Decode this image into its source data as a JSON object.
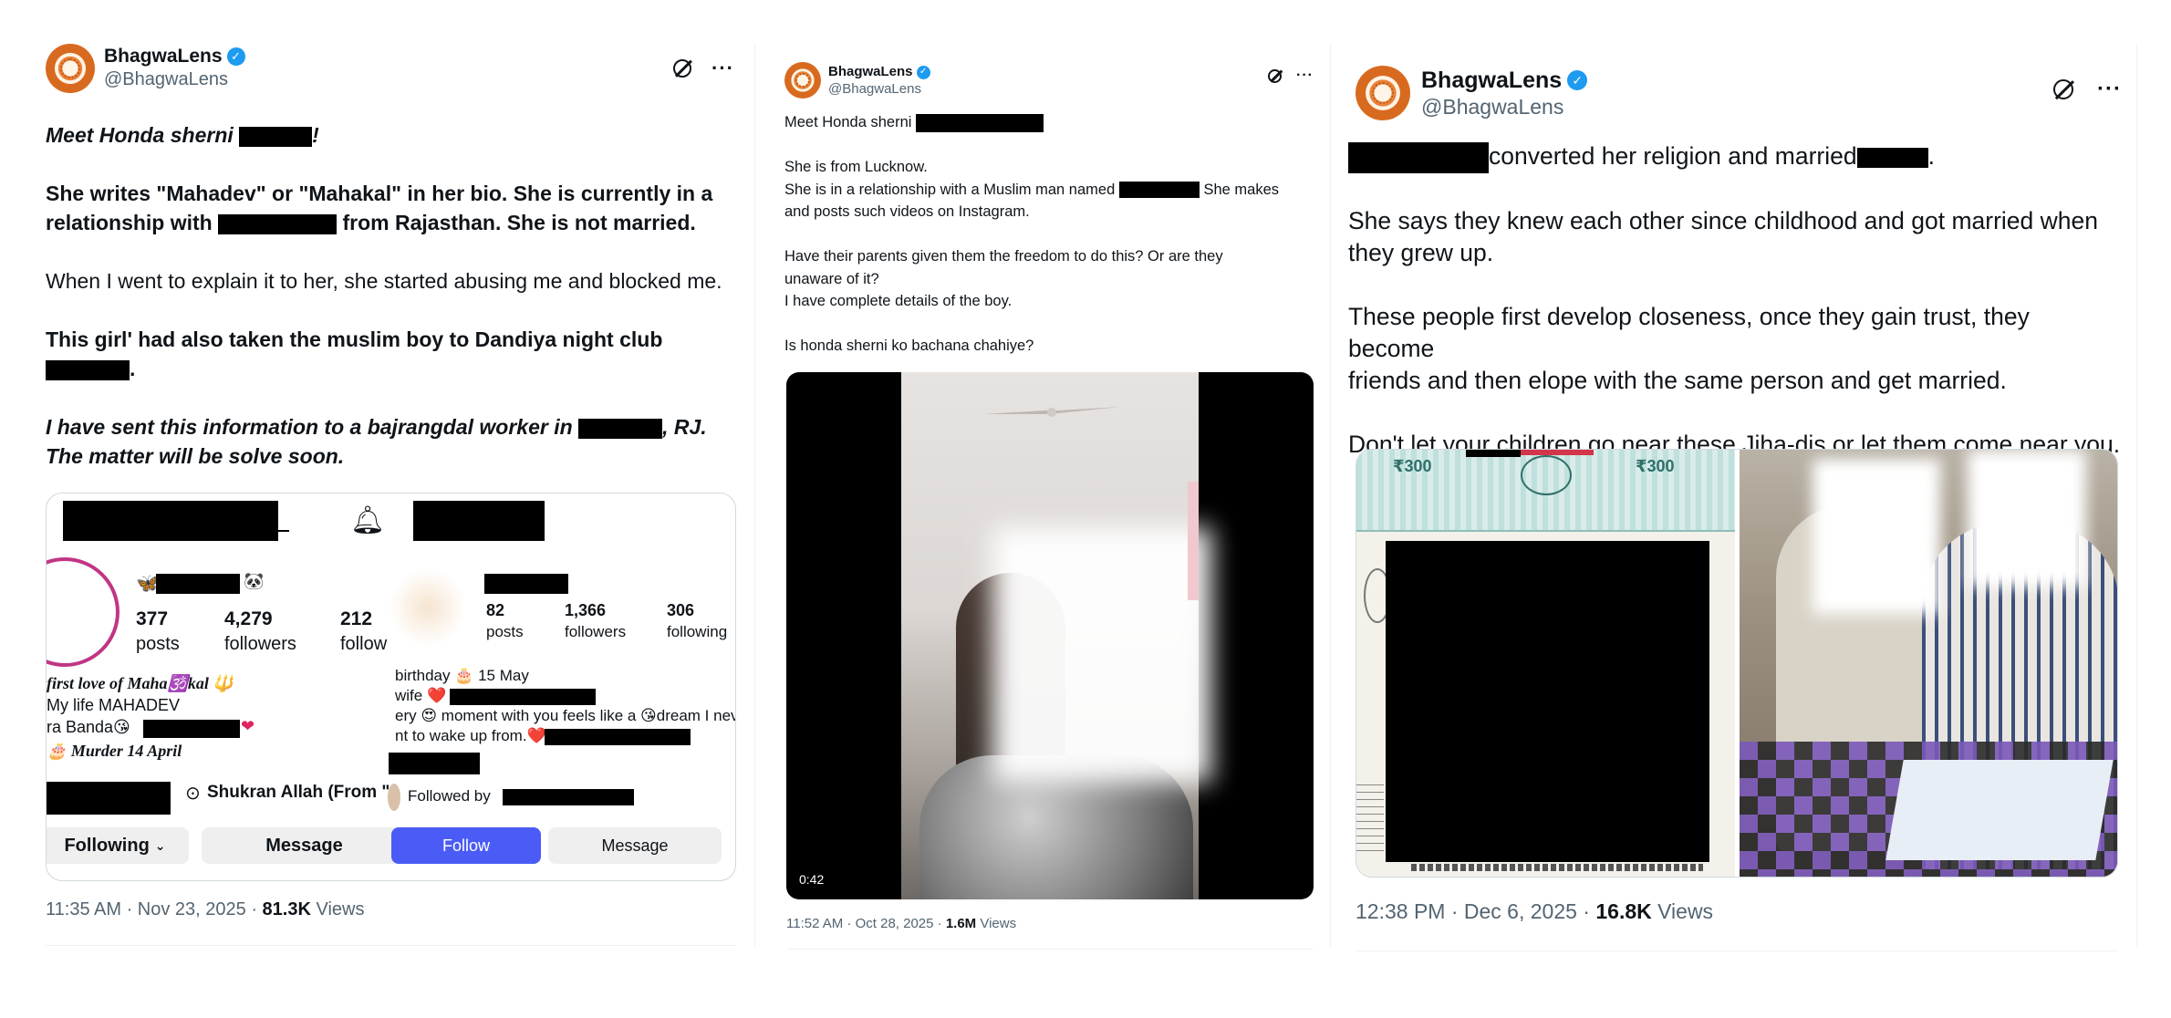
{
  "panel1": {
    "name": "BhagwaLens",
    "handle": "@BhagwaLens",
    "l1_pre": "Meet Honda sherni",
    "l1_post": "!",
    "l2a": "She writes \"Mahadev\" or \"Mahakal\" in her bio. She is currently in a",
    "l2b_pre": "relationship with",
    "l2b_post": "from Rajasthan. She is not married.",
    "l3": "When I went to explain it to her, she started abusing me and blocked me.",
    "l4a": "This girl' had also taken the muslim boy to Dandiya night club",
    "l4b_post": ".",
    "l5a_pre": "I have sent this information to a bajrangdal worker in",
    "l5a_post": ", RJ.",
    "l5b": "The matter will be solve soon.",
    "timestamp": "11:35 AM · Nov 23, 2025 ·",
    "views_count": "81.3K",
    "views_label": "Views",
    "ig": {
      "left": {
        "posts_num": "377",
        "posts_lbl": "posts",
        "followers_num": "4,279",
        "followers_lbl": "followers",
        "following_num": "212",
        "following_lbl": "follow",
        "bio1": "first love of Maha🕉️kal 🔱",
        "bio2": "My life MAHADEV",
        "bio3_pre": "ra Banda😘",
        "bio4": "🎂 Murder 14 April",
        "story": "Shukran Allah (From \"",
        "following_btn": "Following",
        "message_btn": "Message"
      },
      "right": {
        "posts_num": "82",
        "posts_lbl": "posts",
        "followers_num": "1,366",
        "followers_lbl": "followers",
        "following_num": "306",
        "following_lbl": "following",
        "bio1": "birthday 🎂 15 May",
        "bio2": "wife ❤️",
        "bio3": "ery 😍 moment with you feels like a 😘dream I nev",
        "bio4": "nt to wake up from.❤️",
        "followed_by": "Followed by",
        "follow_btn": "Follow",
        "message_btn": "Message"
      }
    }
  },
  "panel2": {
    "name": "BhagwaLens",
    "handle": "@BhagwaLens",
    "l1_pre": "Meet Honda sherni",
    "l2": "She is from Lucknow.",
    "l3_pre": "She is in a relationship with a Muslim man named",
    "l3_post": "She makes",
    "l4": "and posts such videos on Instagram.",
    "l5": "Have their parents given them the freedom to do this? Or are they",
    "l6": "unaware of it?",
    "l7": "I have complete details of the boy.",
    "l8": "Is honda sherni ko bachana chahiye?",
    "video_time": "0:42",
    "timestamp": "11:52 AM · Oct 28, 2025 ·",
    "views_count": "1.6M",
    "views_label": "Views"
  },
  "panel3": {
    "name": "BhagwaLens",
    "handle": "@BhagwaLens",
    "l1_mid": "converted her religion and married",
    "l1_end": ".",
    "l2a": "She says they knew each other since childhood and got married when",
    "l2b": "they grew up.",
    "l3a": "These people first develop closeness, once they gain trust, they become",
    "l3b": "friends and then elope with the same person and get married.",
    "l4": "Don't let your children go near these Jiha-dis or let them come near you.",
    "stamp_left": "₹300",
    "stamp_right": "₹300",
    "timestamp": "12:38 PM · Dec 6, 2025 ·",
    "views_count": "16.8K",
    "views_label": "Views"
  },
  "colors": {
    "verified": "#1d9bf0",
    "secondary_text": "#536471",
    "follow_button": "#4a5cf5"
  }
}
